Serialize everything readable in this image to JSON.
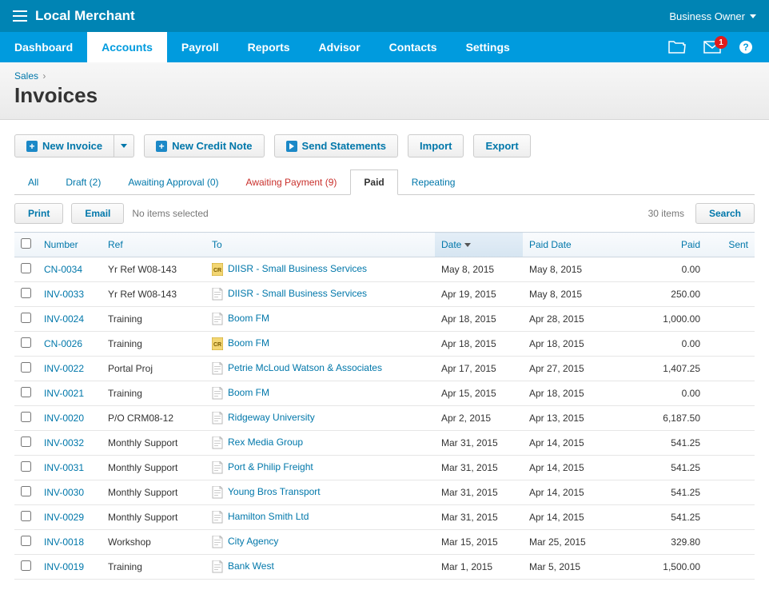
{
  "header": {
    "app_name": "Local Merchant",
    "user_label": "Business Owner"
  },
  "nav": {
    "items": [
      "Dashboard",
      "Accounts",
      "Payroll",
      "Reports",
      "Advisor",
      "Contacts",
      "Settings"
    ],
    "active_index": 1,
    "notification_count": "1"
  },
  "breadcrumb": {
    "parent": "Sales",
    "sep": "›"
  },
  "page_title": "Invoices",
  "actions": {
    "new_invoice": "New Invoice",
    "new_credit_note": "New Credit Note",
    "send_statements": "Send Statements",
    "import": "Import",
    "export": "Export"
  },
  "tabs": [
    {
      "label": "All",
      "alert": false,
      "active": false
    },
    {
      "label": "Draft (2)",
      "alert": false,
      "active": false
    },
    {
      "label": "Awaiting Approval (0)",
      "alert": false,
      "active": false
    },
    {
      "label": "Awaiting Payment (9)",
      "alert": true,
      "active": false
    },
    {
      "label": "Paid",
      "alert": false,
      "active": true
    },
    {
      "label": "Repeating",
      "alert": false,
      "active": false
    }
  ],
  "toolbar": {
    "print": "Print",
    "email": "Email",
    "selection": "No items selected",
    "count": "30 items",
    "search": "Search"
  },
  "columns": {
    "number": "Number",
    "ref": "Ref",
    "to": "To",
    "date": "Date",
    "paid_date": "Paid Date",
    "paid": "Paid",
    "sent": "Sent"
  },
  "rows": [
    {
      "number": "CN-0034",
      "ref": "Yr Ref W08-143",
      "icon": "cr",
      "to": "DIISR - Small Business Services",
      "date": "May 8, 2015",
      "paid_date": "May 8, 2015",
      "paid": "0.00",
      "sent": ""
    },
    {
      "number": "INV-0033",
      "ref": "Yr Ref W08-143",
      "icon": "doc",
      "to": "DIISR - Small Business Services",
      "date": "Apr 19, 2015",
      "paid_date": "May 8, 2015",
      "paid": "250.00",
      "sent": ""
    },
    {
      "number": "INV-0024",
      "ref": "Training",
      "icon": "doc",
      "to": "Boom FM",
      "date": "Apr 18, 2015",
      "paid_date": "Apr 28, 2015",
      "paid": "1,000.00",
      "sent": ""
    },
    {
      "number": "CN-0026",
      "ref": "Training",
      "icon": "cr",
      "to": "Boom FM",
      "date": "Apr 18, 2015",
      "paid_date": "Apr 18, 2015",
      "paid": "0.00",
      "sent": ""
    },
    {
      "number": "INV-0022",
      "ref": "Portal Proj",
      "icon": "doc",
      "to": "Petrie McLoud Watson & Associates",
      "date": "Apr 17, 2015",
      "paid_date": "Apr 27, 2015",
      "paid": "1,407.25",
      "sent": ""
    },
    {
      "number": "INV-0021",
      "ref": "Training",
      "icon": "doc",
      "to": "Boom FM",
      "date": "Apr 15, 2015",
      "paid_date": "Apr 18, 2015",
      "paid": "0.00",
      "sent": ""
    },
    {
      "number": "INV-0020",
      "ref": "P/O CRM08-12",
      "icon": "doc",
      "to": "Ridgeway University",
      "date": "Apr 2, 2015",
      "paid_date": "Apr 13, 2015",
      "paid": "6,187.50",
      "sent": ""
    },
    {
      "number": "INV-0032",
      "ref": "Monthly Support",
      "icon": "doc",
      "to": "Rex Media Group",
      "date": "Mar 31, 2015",
      "paid_date": "Apr 14, 2015",
      "paid": "541.25",
      "sent": ""
    },
    {
      "number": "INV-0031",
      "ref": "Monthly Support",
      "icon": "doc",
      "to": "Port & Philip Freight",
      "date": "Mar 31, 2015",
      "paid_date": "Apr 14, 2015",
      "paid": "541.25",
      "sent": ""
    },
    {
      "number": "INV-0030",
      "ref": "Monthly Support",
      "icon": "doc",
      "to": "Young Bros Transport",
      "date": "Mar 31, 2015",
      "paid_date": "Apr 14, 2015",
      "paid": "541.25",
      "sent": ""
    },
    {
      "number": "INV-0029",
      "ref": "Monthly Support",
      "icon": "doc",
      "to": "Hamilton Smith Ltd",
      "date": "Mar 31, 2015",
      "paid_date": "Apr 14, 2015",
      "paid": "541.25",
      "sent": ""
    },
    {
      "number": "INV-0018",
      "ref": "Workshop",
      "icon": "doc",
      "to": "City Agency",
      "date": "Mar 15, 2015",
      "paid_date": "Mar 25, 2015",
      "paid": "329.80",
      "sent": ""
    },
    {
      "number": "INV-0019",
      "ref": "Training",
      "icon": "doc",
      "to": "Bank West",
      "date": "Mar 1, 2015",
      "paid_date": "Mar 5, 2015",
      "paid": "1,500.00",
      "sent": ""
    }
  ]
}
